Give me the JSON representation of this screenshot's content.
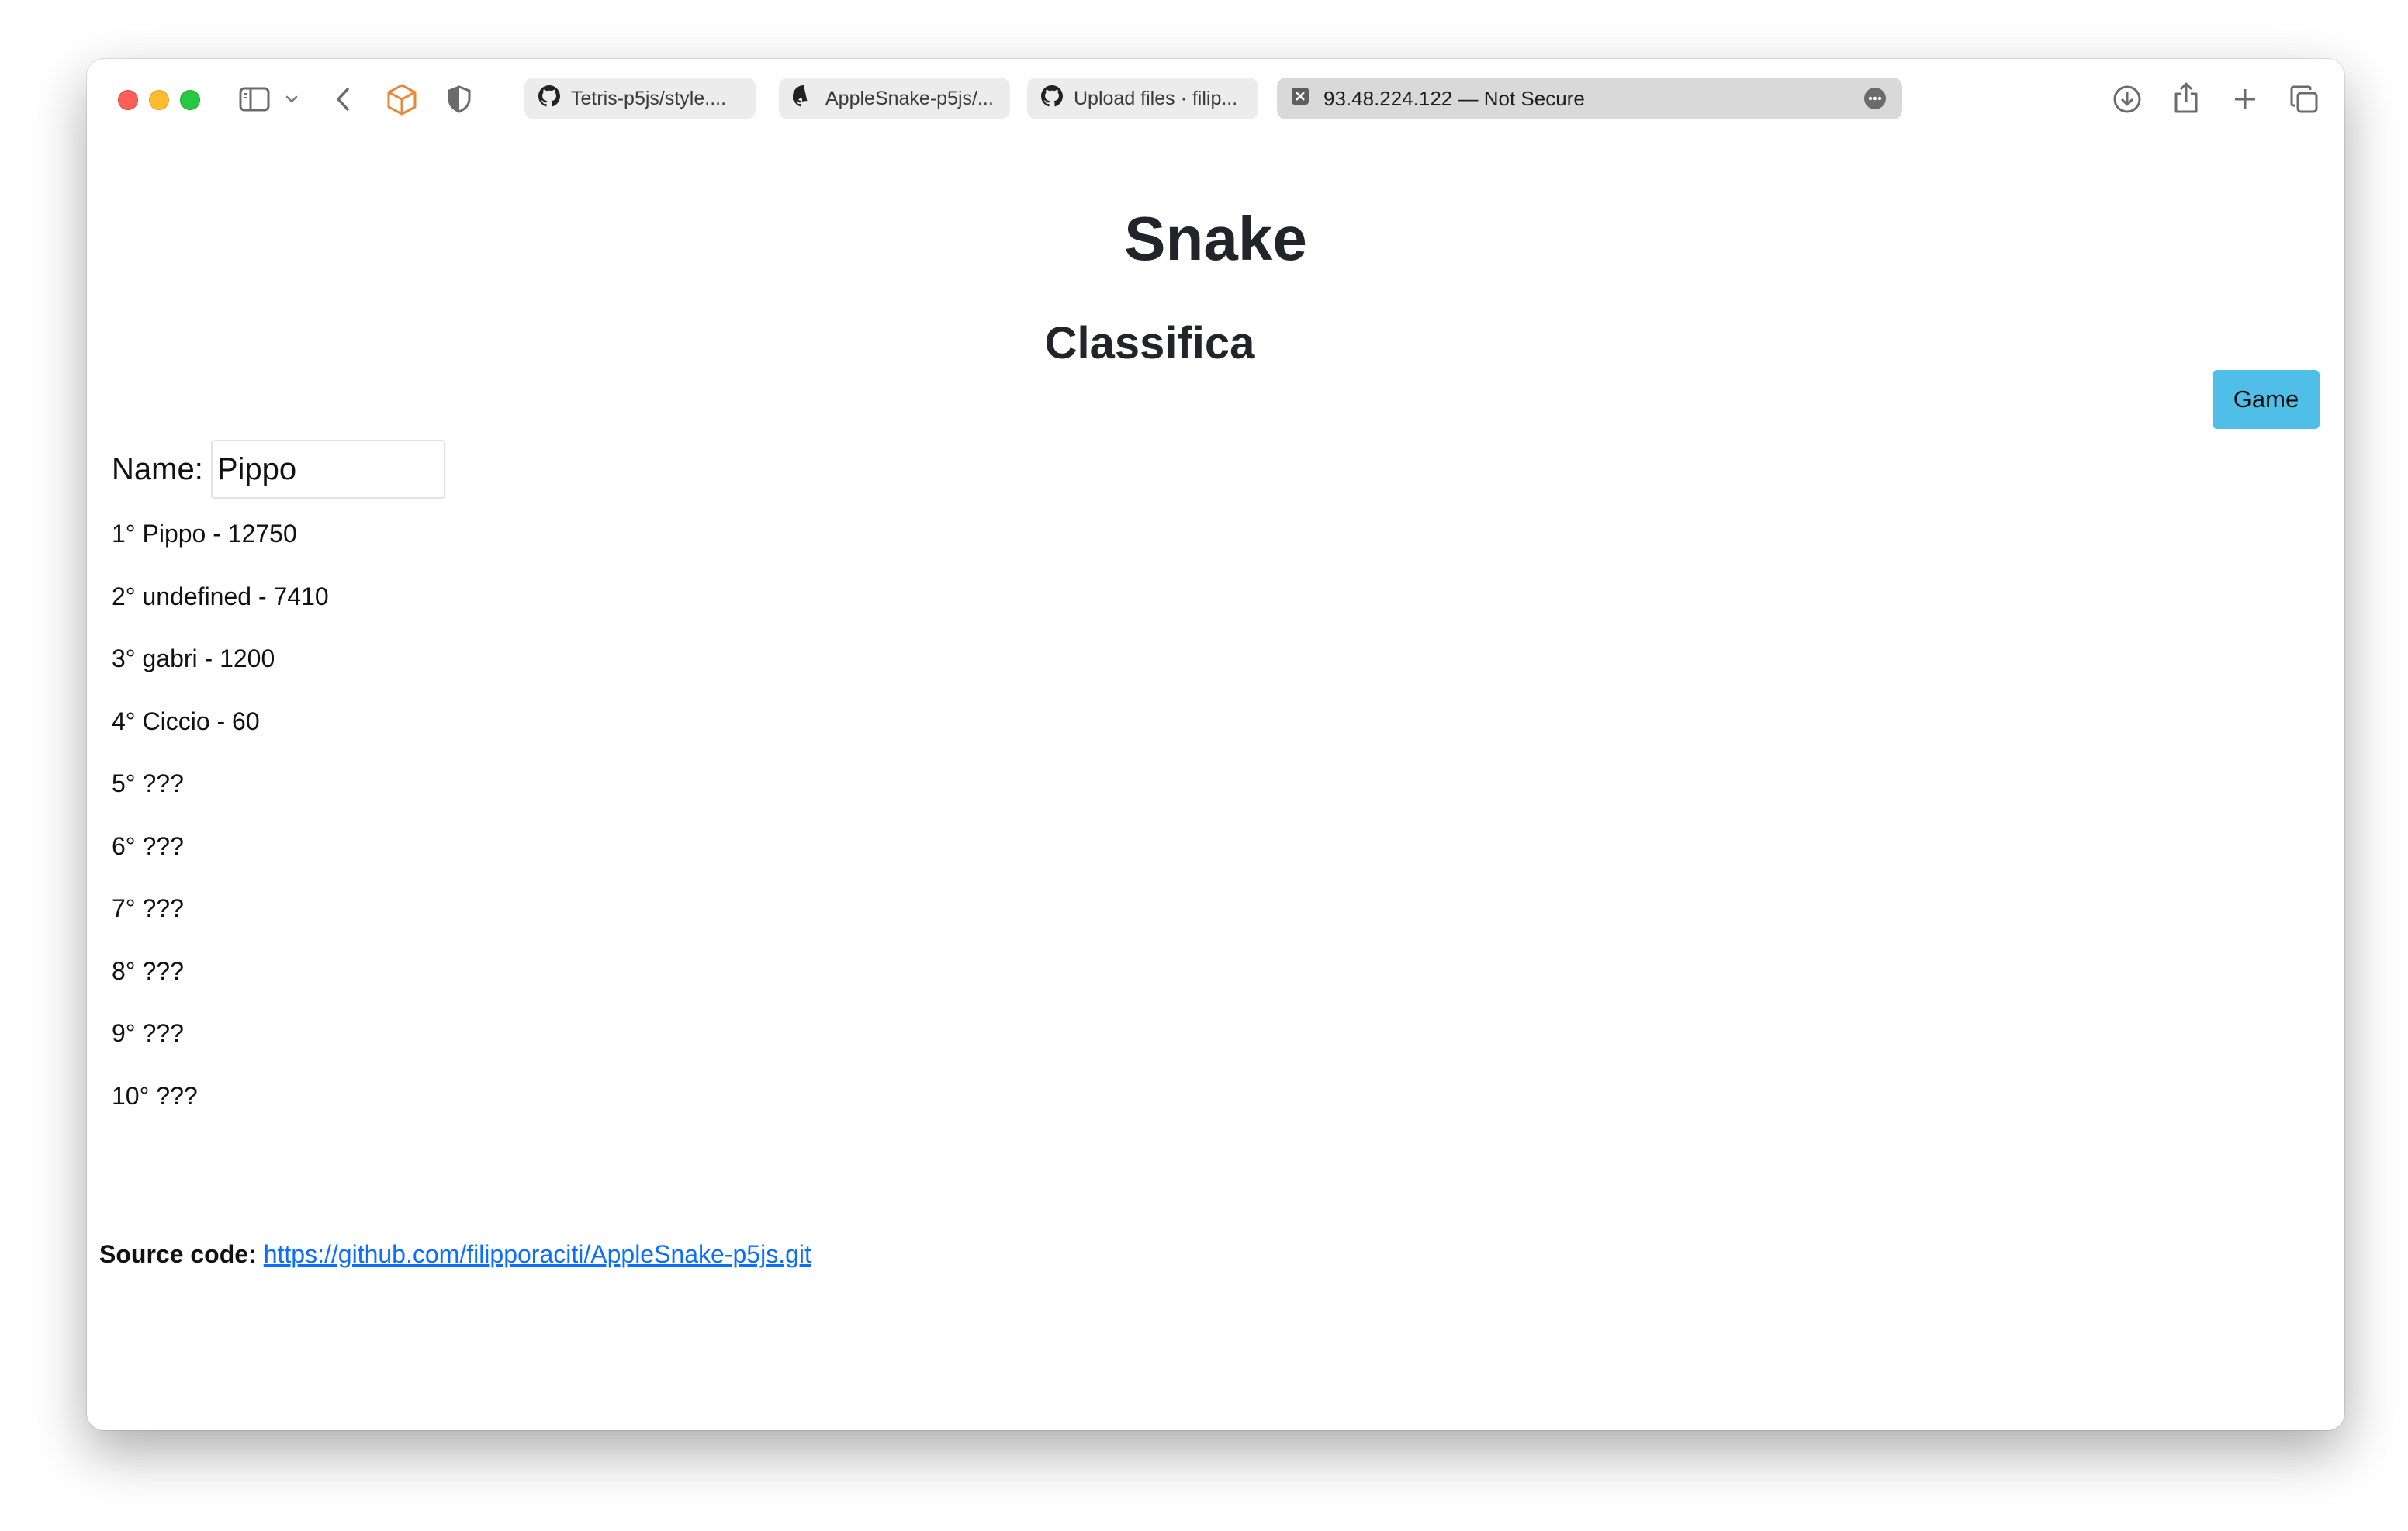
{
  "browser": {
    "tabs": [
      {
        "label": "Tetris-p5js/style....",
        "icon": "github-icon",
        "active": false
      },
      {
        "label": "AppleSnake-p5js/...",
        "icon": "github-icon",
        "active": false
      },
      {
        "label": "Upload files · filip...",
        "icon": "github-icon",
        "active": false
      },
      {
        "label": "93.48.224.122 — Not Secure",
        "icon": "not-secure-icon",
        "active": true
      }
    ],
    "colors": {
      "red": "#ff5f57",
      "yellow": "#febc2e",
      "green": "#28c840"
    }
  },
  "page": {
    "title": "Snake",
    "section_title": "Classifica",
    "game_button": "Game",
    "name_label": "Name:",
    "name_value": "Pippo",
    "ranking": [
      "1° Pippo - 12750",
      "2° undefined - 7410",
      "3° gabri - 1200",
      "4° Ciccio - 60",
      "5° ???",
      "6° ???",
      "7° ???",
      "8° ???",
      "9° ???",
      "10° ???"
    ],
    "source_label": "Source code:",
    "source_link": "https://github.com/filipporaciti/AppleSnake-p5js.git",
    "accent_color": "#4fbfe8",
    "link_color": "#0d6efd"
  }
}
